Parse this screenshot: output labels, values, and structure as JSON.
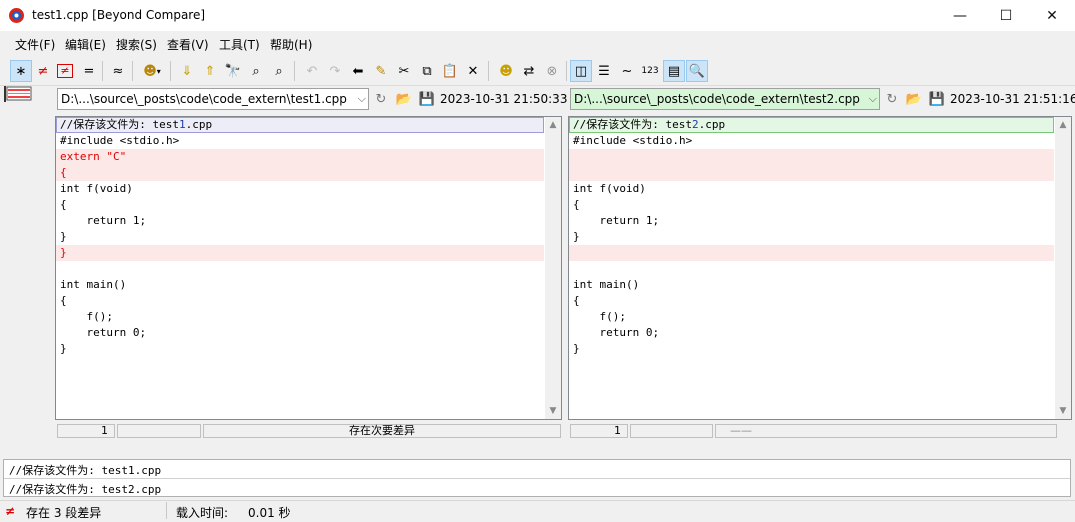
{
  "window": {
    "title": "test1.cpp  [Beyond Compare]",
    "controls": {
      "minimize": "—",
      "maximize": "☐",
      "close": "✕"
    }
  },
  "menu": [
    "文件(F)",
    "编辑(E)",
    "搜索(S)",
    "查看(V)",
    "工具(T)",
    "帮助(H)"
  ],
  "toolbar": {
    "numbers_label": "123"
  },
  "left": {
    "path": "D:\\...\\source\\_posts\\code\\code_extern\\test1.cpp",
    "timestamp": "2023-10-31 21:50:33",
    "lines": [
      {
        "text": "//保存该文件为: test",
        "suffix_blue": "1",
        "tail": ".cpp",
        "kind": "first"
      },
      {
        "text": "#include <stdio.h>",
        "kind": "normal"
      },
      {
        "text": "extern \"C\"",
        "kind": "diff"
      },
      {
        "text": "{",
        "kind": "diff"
      },
      {
        "text": "int f(void)",
        "kind": "normal"
      },
      {
        "text": "{",
        "kind": "normal"
      },
      {
        "text": "    return 1;",
        "kind": "normal"
      },
      {
        "text": "}",
        "kind": "normal"
      },
      {
        "text": "}",
        "kind": "diff"
      },
      {
        "text": "",
        "kind": "normal"
      },
      {
        "text": "int main()",
        "kind": "normal"
      },
      {
        "text": "{",
        "kind": "normal"
      },
      {
        "text": "    f();",
        "kind": "normal"
      },
      {
        "text": "    return 0;",
        "kind": "normal"
      },
      {
        "text": "}",
        "kind": "normal"
      }
    ],
    "status": {
      "line": "1",
      "col": "",
      "note": "存在次要差异"
    }
  },
  "right": {
    "path": "D:\\...\\source\\_posts\\code\\code_extern\\test2.cpp",
    "timestamp": "2023-10-31 21:51:16",
    "lines": [
      {
        "text": "//保存该文件为: test",
        "suffix_blue": "2",
        "tail": ".cpp",
        "kind": "first"
      },
      {
        "text": "#include <stdio.h>",
        "kind": "normal"
      },
      {
        "text": "",
        "kind": "diff"
      },
      {
        "text": "",
        "kind": "diff"
      },
      {
        "text": "int f(void)",
        "kind": "normal"
      },
      {
        "text": "{",
        "kind": "normal"
      },
      {
        "text": "    return 1;",
        "kind": "normal"
      },
      {
        "text": "}",
        "kind": "normal"
      },
      {
        "text": "",
        "kind": "diff"
      },
      {
        "text": "",
        "kind": "normal"
      },
      {
        "text": "int main()",
        "kind": "normal"
      },
      {
        "text": "{",
        "kind": "normal"
      },
      {
        "text": "    f();",
        "kind": "normal"
      },
      {
        "text": "    return 0;",
        "kind": "normal"
      },
      {
        "text": "}",
        "kind": "normal"
      }
    ],
    "status": {
      "line": "1",
      "col": "",
      "note": "——"
    }
  },
  "compare_lines": [
    "//保存该文件为: test1.cpp",
    "//保存该文件为: test2.cpp"
  ],
  "statusbar": {
    "diff_count": "存在 3 段差异",
    "load_time_label": "载入时间:",
    "load_time_value": "0.01 秒"
  },
  "colors": {
    "diff_bg": "#fde8e8",
    "diff_text": "#e00000",
    "right_path_bg": "#d7f5d7"
  }
}
